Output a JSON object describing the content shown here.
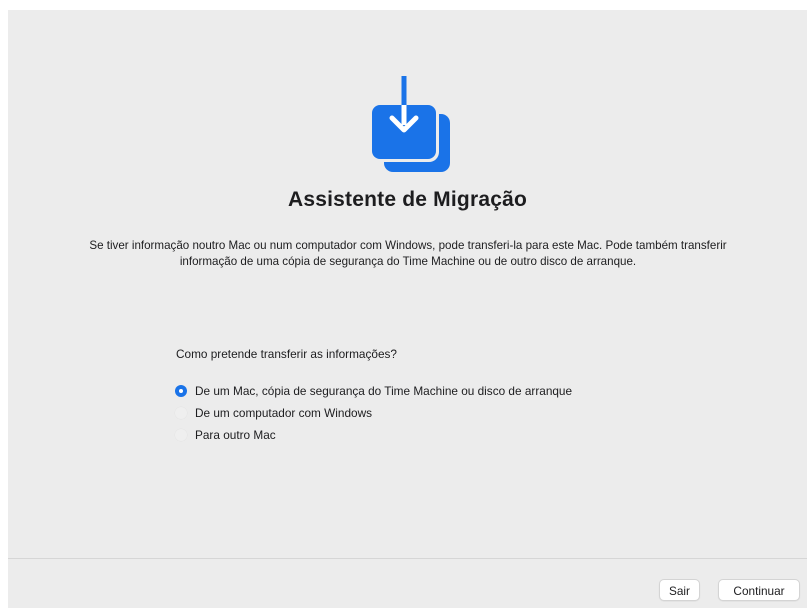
{
  "window": {
    "title": "Assistente de Migração",
    "description": "Se tiver informação noutro Mac ou num computador com Windows, pode transferi-la para este Mac. Pode também transferir informação de uma cópia de segurança do Time Machine ou de outro disco de arranque."
  },
  "icon": {
    "name": "migration-assistant-icon",
    "color": "#1a73e8"
  },
  "transfer": {
    "question": "Como pretende transferir as informações?",
    "options": [
      {
        "label": "De um Mac, cópia de segurança do Time Machine ou disco de arranque",
        "selected": true
      },
      {
        "label": "De um computador com Windows",
        "selected": false
      },
      {
        "label": "Para outro Mac",
        "selected": false
      }
    ]
  },
  "footer": {
    "quit_label": "Sair",
    "continue_label": "Continuar"
  },
  "colors": {
    "accent": "#1a73e8",
    "background": "#ececec"
  }
}
